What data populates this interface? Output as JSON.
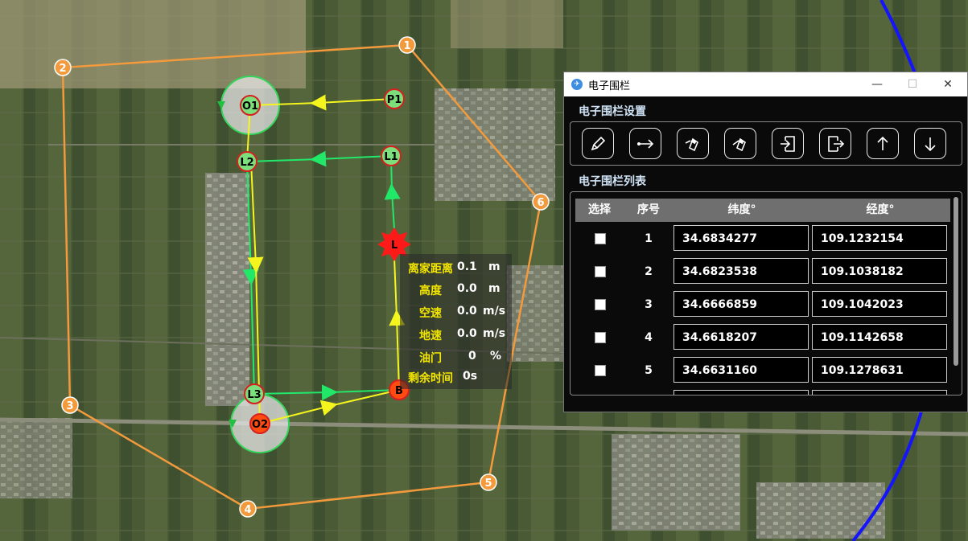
{
  "map": {
    "fence_points": [
      {
        "label": "1"
      },
      {
        "label": "2"
      },
      {
        "label": "3"
      },
      {
        "label": "4"
      },
      {
        "label": "5"
      },
      {
        "label": "6"
      }
    ],
    "waypoints": {
      "p1": "P1",
      "o1": "O1",
      "l1": "L1",
      "l2": "L2",
      "l3": "L3",
      "o2": "O2",
      "b": "B",
      "l": "L"
    },
    "colors": {
      "fence": "#f39a3c",
      "route_yellow": "#f5f51e",
      "route_green": "#22e86a",
      "boundary_blue": "#1414ff"
    }
  },
  "telemetry": {
    "rows": [
      {
        "label": "离家距离",
        "value": "0.1",
        "unit": "m"
      },
      {
        "label": "高度",
        "value": "0.0",
        "unit": "m"
      },
      {
        "label": "空速",
        "value": "0.0",
        "unit": "m/s"
      },
      {
        "label": "地速",
        "value": "0.0",
        "unit": "m/s"
      },
      {
        "label": "油门",
        "value": "0",
        "unit": "%"
      },
      {
        "label": "剩余时间",
        "value": "0s",
        "unit": ""
      }
    ]
  },
  "window": {
    "title": "电子围栏",
    "minimize": "—",
    "maximize": "☐",
    "close": "✕",
    "settings_title": "电子围栏设置",
    "list_title": "电子围栏列表",
    "tools": [
      {
        "icon": "pencil-icon"
      },
      {
        "icon": "arrow-right-point-icon"
      },
      {
        "icon": "eraser-icon"
      },
      {
        "icon": "eraser-alt-icon"
      },
      {
        "icon": "import-icon"
      },
      {
        "icon": "export-icon"
      },
      {
        "icon": "arrow-up-icon"
      },
      {
        "icon": "arrow-down-icon"
      }
    ],
    "table": {
      "headers": {
        "select": "选择",
        "index": "序号",
        "lat": "纬度°",
        "lon": "经度°"
      },
      "rows": [
        {
          "index": "1",
          "lat": "34.6834277",
          "lon": "109.1232154"
        },
        {
          "index": "2",
          "lat": "34.6823538",
          "lon": "109.1038182"
        },
        {
          "index": "3",
          "lat": "34.6666859",
          "lon": "109.1042023"
        },
        {
          "index": "4",
          "lat": "34.6618207",
          "lon": "109.1142658"
        },
        {
          "index": "5",
          "lat": "34.6631160",
          "lon": "109.1278631"
        }
      ]
    }
  }
}
